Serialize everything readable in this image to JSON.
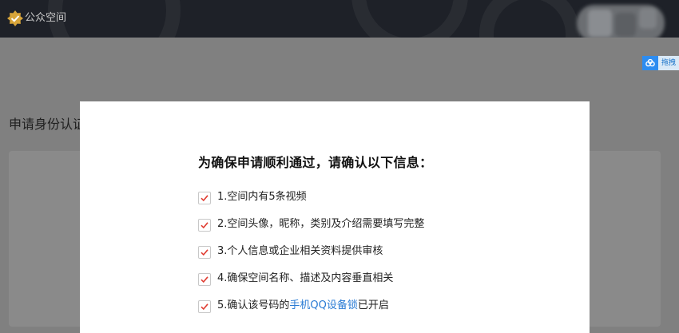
{
  "header": {
    "logo_icon": "verified-badge-icon",
    "logo_text": "公众空间"
  },
  "side_tag": {
    "icon": "baidu-cloud-icon",
    "label": "拖拽"
  },
  "page": {
    "title": "申请身份认证"
  },
  "modal": {
    "heading": "为确保申请顺利通过，请确认以下信息：",
    "items": [
      {
        "text": "1.空间内有5条视频",
        "checked": true
      },
      {
        "text": "2.空间头像，昵称，类别及介绍需要填写完整",
        "checked": true
      },
      {
        "text": "3.个人信息或企业相关资料提供审核",
        "checked": true
      },
      {
        "text": "4.确保空间名称、描述及内容垂直相关",
        "checked": true
      },
      {
        "text_before": "5.确认该号码的",
        "link": "手机QQ设备锁",
        "text_after": "已开启",
        "checked": true
      }
    ]
  },
  "colors": {
    "topbar": "#1e2128",
    "overlay": "#808080",
    "check_mark": "#e03c31",
    "link": "#2a7bd4",
    "logo_gold": "#d8a53a"
  }
}
